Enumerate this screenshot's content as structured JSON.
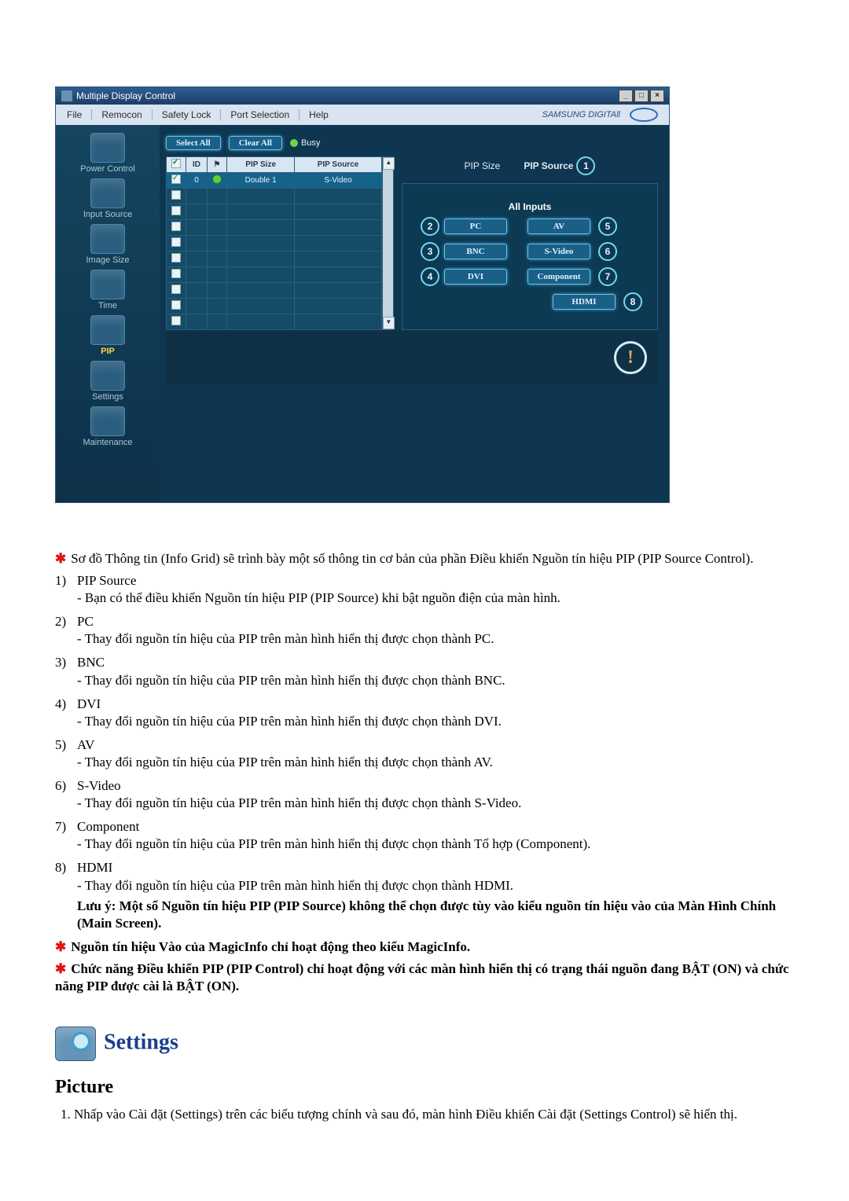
{
  "app": {
    "title": "Multiple Display Control",
    "brand": "SAMSUNG DIGITAll",
    "winbuttons": {
      "min": "_",
      "max": "□",
      "close": "×"
    },
    "menu": [
      "File",
      "Remocon",
      "Safety Lock",
      "Port Selection",
      "Help"
    ],
    "sidebar": [
      {
        "label": "Power Control"
      },
      {
        "label": "Input Source"
      },
      {
        "label": "Image Size"
      },
      {
        "label": "Time"
      },
      {
        "label": "PIP",
        "active": true
      },
      {
        "label": "Settings"
      },
      {
        "label": "Maintenance"
      }
    ],
    "toolbar": {
      "select_all": "Select All",
      "clear_all": "Clear All",
      "busy": "Busy"
    },
    "grid": {
      "headers": [
        "",
        "ID",
        "",
        "PIP Size",
        "PIP Source"
      ],
      "rows": [
        {
          "sel": true,
          "id": "0",
          "status": true,
          "size": "Double 1",
          "source": "S-Video"
        },
        {
          "sel": false
        },
        {
          "sel": false
        },
        {
          "sel": false
        },
        {
          "sel": false
        },
        {
          "sel": false
        },
        {
          "sel": false
        },
        {
          "sel": false
        },
        {
          "sel": false
        },
        {
          "sel": false
        }
      ]
    },
    "tabs": {
      "size": "PIP Size",
      "source": "PIP Source",
      "badge": "1"
    },
    "all_inputs": "All Inputs",
    "buttons_left": [
      {
        "n": "2",
        "l": "PC"
      },
      {
        "n": "3",
        "l": "BNC"
      },
      {
        "n": "4",
        "l": "DVI"
      }
    ],
    "buttons_right": [
      {
        "n": "5",
        "l": "AV"
      },
      {
        "n": "6",
        "l": "S-Video"
      },
      {
        "n": "7",
        "l": "Component"
      },
      {
        "n": "8",
        "l": "HDMI"
      }
    ]
  },
  "doc": {
    "intro": "Sơ đồ Thông tin (Info Grid) sẽ trình bày một số thông tin cơ bản của phần Điều khiển Nguồn tín hiệu PIP (PIP Source Control).",
    "items": [
      {
        "n": "1",
        "t": "PIP Source",
        "d": "- Bạn có thể điều khiển Nguồn tín hiệu PIP (PIP Source) khi bật nguồn điện của màn hình."
      },
      {
        "n": "2",
        "t": "PC",
        "d": "- Thay đổi nguồn tín hiệu của PIP trên màn hình hiển thị được chọn thành PC."
      },
      {
        "n": "3",
        "t": "BNC",
        "d": "- Thay đổi nguồn tín hiệu của PIP trên màn hình hiển thị được chọn thành BNC."
      },
      {
        "n": "4",
        "t": "DVI",
        "d": "- Thay đổi nguồn tín hiệu của PIP trên màn hình hiển thị được chọn thành DVI."
      },
      {
        "n": "5",
        "t": "AV",
        "d": "- Thay đổi nguồn tín hiệu của PIP trên màn hình hiển thị được chọn thành AV."
      },
      {
        "n": "6",
        "t": "S-Video",
        "d": "- Thay đổi nguồn tín hiệu của PIP trên màn hình hiển thị được chọn thành S-Video."
      },
      {
        "n": "7",
        "t": "Component",
        "d": "- Thay đổi nguồn tín hiệu của PIP trên màn hình hiển thị được chọn thành Tổ hợp (Component)."
      },
      {
        "n": "8",
        "t": "HDMI",
        "d": "- Thay đổi nguồn tín hiệu của PIP trên màn hình hiển thị được chọn thành HDMI."
      }
    ],
    "caution": "Lưu ý: Một số Nguồn tín hiệu PIP (PIP Source) không thể chọn được tùy vào kiểu nguồn tín hiệu vào của Màn Hình Chính (Main Screen).",
    "star1": "Nguồn tín hiệu Vào của MagicInfo chỉ hoạt động theo kiểu MagicInfo.",
    "star2": "Chức năng Điều khiển PIP (PIP Control) chỉ hoạt động với các màn hình hiển thị có trạng thái nguồn đang BẬT (ON) và chức năng PIP được cài là BẬT (ON).",
    "settings_heading": "Settings",
    "picture_heading": "Picture",
    "picture_step1": "Nhấp vào Cài đặt (Settings) trên các biểu tượng chính và sau đó, màn hình Điều khiển Cài đặt (Settings Control) sẽ hiển thị."
  }
}
